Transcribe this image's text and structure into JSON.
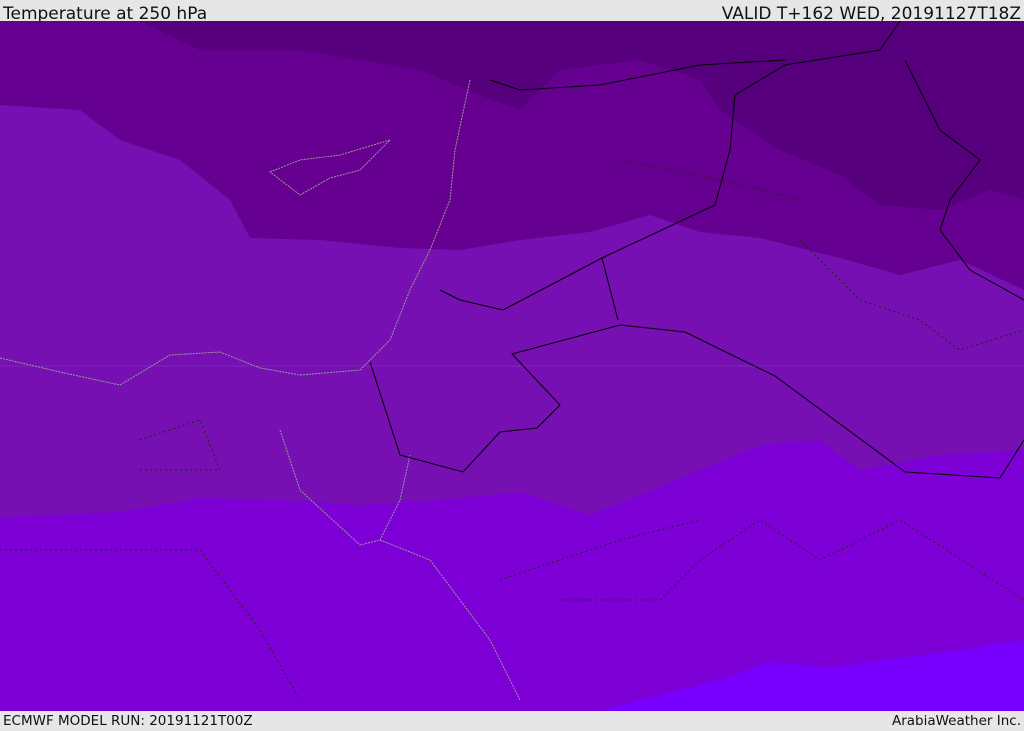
{
  "header": {
    "title": "Temperature at 250 hPa",
    "valid": "VALID T+162 WED, 20191127T18Z"
  },
  "footer": {
    "model_run": "ECMWF MODEL RUN: 20191121T00Z",
    "credit": "ArabiaWeather Inc."
  },
  "colors": {
    "darkest": "#56007e",
    "dark": "#650090",
    "mid": "#7610b2",
    "light": "#7d00d6",
    "lightest": "#7800ff",
    "border": "#000000",
    "coast": "#9a9a9a"
  }
}
